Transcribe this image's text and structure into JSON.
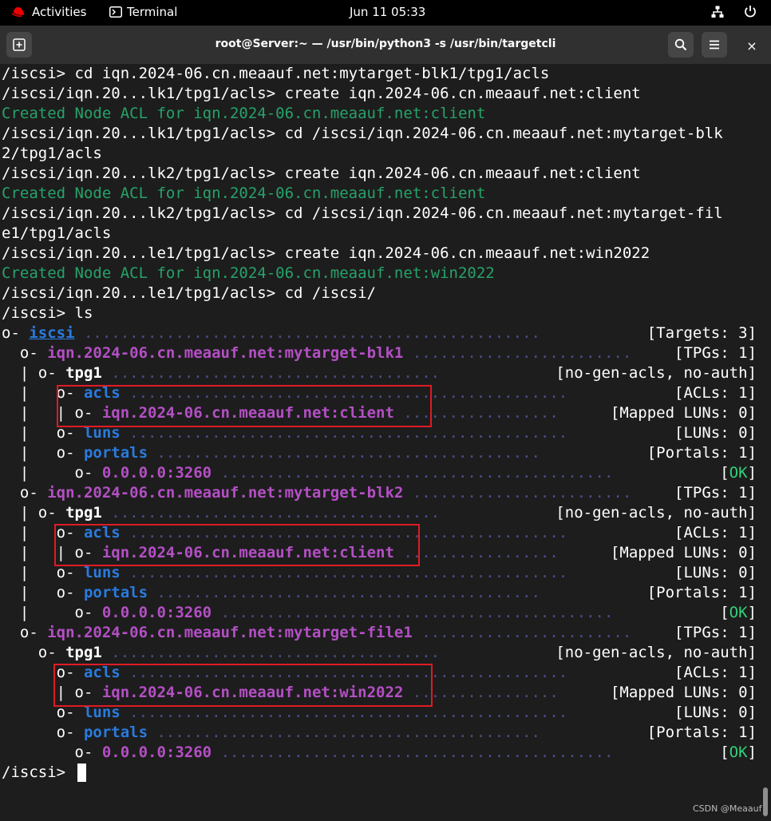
{
  "topbar": {
    "activities": "Activities",
    "app_name": "Terminal",
    "clock": "Jun 11  05:33"
  },
  "window": {
    "title": "root@Server:~ — /usr/bin/python3 -s /usr/bin/targetcli",
    "close_glyph": "×"
  },
  "terminal": {
    "lines": [
      "/iscsi> cd iqn.2024-06.cn.meaauf.net:mytarget-blk1/tpg1/acls",
      "/iscsi/iqn.20...lk1/tpg1/acls> create iqn.2024-06.cn.meaauf.net:client",
      "Created Node ACL for iqn.2024-06.cn.meaauf.net:client",
      "/iscsi/iqn.20...lk1/tpg1/acls> cd /iscsi/iqn.2024-06.cn.meaauf.net:mytarget-blk",
      "2/tpg1/acls",
      "/iscsi/iqn.20...lk2/tpg1/acls> create iqn.2024-06.cn.meaauf.net:client",
      "Created Node ACL for iqn.2024-06.cn.meaauf.net:client",
      "/iscsi/iqn.20...lk2/tpg1/acls> cd /iscsi/iqn.2024-06.cn.meaauf.net:mytarget-fil",
      "e1/tpg1/acls",
      "/iscsi/iqn.20...le1/tpg1/acls> create iqn.2024-06.cn.meaauf.net:win2022",
      "Created Node ACL for iqn.2024-06.cn.meaauf.net:win2022",
      "/iscsi/iqn.20...le1/tpg1/acls> cd /iscsi/",
      "/iscsi> ls"
    ],
    "tree": [
      {
        "prefix": "o- ",
        "name": "iscsi",
        "style": "blue",
        "dots": " .................................................. ",
        "info": "[Targets: 3]"
      },
      {
        "prefix": "  o- ",
        "name": "iqn.2024-06.cn.meaauf.net:mytarget-blk1",
        "style": "purple",
        "dots": " ........................ ",
        "info": "[TPGs: 1]"
      },
      {
        "prefix": "  | o- ",
        "name": "tpg1",
        "style": "white",
        "dots": " .................................... ",
        "info": "[no-gen-acls, no-auth]"
      },
      {
        "prefix": "  |   o- ",
        "name": "acls",
        "style": "blue",
        "dots": " ................................................ ",
        "info": "[ACLs: 1]"
      },
      {
        "prefix": "  |   | o- ",
        "name": "iqn.2024-06.cn.meaauf.net:client",
        "style": "purple",
        "dots": " ................. ",
        "info": "[Mapped LUNs: 0]"
      },
      {
        "prefix": "  |   o- ",
        "name": "luns",
        "style": "blue",
        "dots": " ................................................ ",
        "info": "[LUNs: 0]"
      },
      {
        "prefix": "  |   o- ",
        "name": "portals",
        "style": "blue",
        "dots": " .......................................... ",
        "info": "[Portals: 1]"
      },
      {
        "prefix": "  |     o- ",
        "name": "0.0.0.0:3260",
        "style": "purple",
        "dots": " ........................................... ",
        "info": "[OK]"
      },
      {
        "prefix": "  o- ",
        "name": "iqn.2024-06.cn.meaauf.net:mytarget-blk2",
        "style": "purple",
        "dots": " ........................ ",
        "info": "[TPGs: 1]"
      },
      {
        "prefix": "  | o- ",
        "name": "tpg1",
        "style": "white",
        "dots": " .................................... ",
        "info": "[no-gen-acls, no-auth]"
      },
      {
        "prefix": "  |   o- ",
        "name": "acls",
        "style": "blue",
        "dots": " ................................................ ",
        "info": "[ACLs: 1]"
      },
      {
        "prefix": "  |   | o- ",
        "name": "iqn.2024-06.cn.meaauf.net:client",
        "style": "purple",
        "dots": " ................. ",
        "info": "[Mapped LUNs: 0]"
      },
      {
        "prefix": "  |   o- ",
        "name": "luns",
        "style": "blue",
        "dots": " ................................................ ",
        "info": "[LUNs: 0]"
      },
      {
        "prefix": "  |   o- ",
        "name": "portals",
        "style": "blue",
        "dots": " .......................................... ",
        "info": "[Portals: 1]"
      },
      {
        "prefix": "  |     o- ",
        "name": "0.0.0.0:3260",
        "style": "purple",
        "dots": " ........................................... ",
        "info": "[OK]"
      },
      {
        "prefix": "  o- ",
        "name": "iqn.2024-06.cn.meaauf.net:mytarget-file1",
        "style": "purple",
        "dots": " ....................... ",
        "info": "[TPGs: 1]"
      },
      {
        "prefix": "    o- ",
        "name": "tpg1",
        "style": "white",
        "dots": " .................................... ",
        "info": "[no-gen-acls, no-auth]"
      },
      {
        "prefix": "      o- ",
        "name": "acls",
        "style": "blue",
        "dots": " ................................................ ",
        "info": "[ACLs: 1]"
      },
      {
        "prefix": "      | o- ",
        "name": "iqn.2024-06.cn.meaauf.net:win2022",
        "style": "purple",
        "dots": " ................ ",
        "info": "[Mapped LUNs: 0]"
      },
      {
        "prefix": "      o- ",
        "name": "luns",
        "style": "blue",
        "dots": " ................................................ ",
        "info": "[LUNs: 0]"
      },
      {
        "prefix": "      o- ",
        "name": "portals",
        "style": "blue",
        "dots": " .......................................... ",
        "info": "[Portals: 1]"
      },
      {
        "prefix": "        o- ",
        "name": "0.0.0.0:3260",
        "style": "purple",
        "dots": " ........................................... ",
        "info": "[OK]"
      }
    ],
    "prompt": "/iscsi> "
  },
  "watermark": "CSDN @Meaauf",
  "colors": {
    "background": "#1d1d1d",
    "green": "#26a269",
    "blue": "#2a7bde",
    "purple": "#b44fc5",
    "highlight": "#e01b24"
  }
}
